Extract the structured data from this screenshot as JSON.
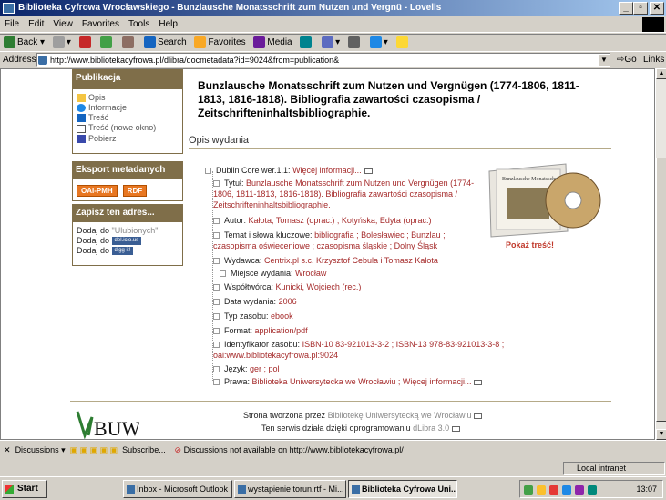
{
  "window": {
    "title": "Biblioteka Cyfrowa Wrocławskiego - Bunzlausche Monatsschrift zum Nutzen und Vergnü - Lovells",
    "menu": [
      "File",
      "Edit",
      "View",
      "Favorites",
      "Tools",
      "Help"
    ],
    "toolbar": {
      "back": "Back",
      "search": "Search",
      "favorites": "Favorites",
      "media": "Media"
    },
    "address_label": "Address",
    "url": "http://www.bibliotekacyfrowa.pl/dlibra/docmetadata?id=9024&from=publication&",
    "go": "Go",
    "links": "Links"
  },
  "sidebar": {
    "publication_title": "Publikacja",
    "publication_links": [
      "Opis",
      "Informacje",
      "Treść",
      "Treść (nowe okno)",
      "Pobierz"
    ],
    "export_title": "Eksport metadanych",
    "export_oai": "OAI-PMH",
    "export_rdf": "RDF",
    "save_title": "Zapisz ten adres...",
    "save_line1_prefix": "Dodaj do",
    "save_line1_value": "\"Ulubionych\"",
    "save_line2": "Dodaj do",
    "save_line3": "Dodaj do",
    "logo_delicious": "del.icio.us",
    "logo_digg": "digg it!"
  },
  "main": {
    "title": "Bunzlausche Monatsschrift zum Nutzen und Vergnügen (1774-1806, 1811-1813, 1816-1818). Bibliografia zawartości czasopisma / Zeitschrifteninhaltsbibliographie.",
    "section": "Opis wydania",
    "dublin_core_label": "Dublin Core wer.1.1:",
    "dublin_core_link": "Więcej informacji...",
    "fields": {
      "title_label": "Tytuł:",
      "title_value": "Bunzlausche Monatsschrift zum Nutzen und Vergnügen (1774-1806, 1811-1813, 1816-1818). Bibliografia zawartości czasopisma / Zeitschrifteninhaltsbibliographie.",
      "author_label": "Autor:",
      "author_value": "Kałota, Tomasz (oprac.) ; Kotyńska, Edyta (oprac.)",
      "subject_label": "Temat i słowa kluczowe:",
      "subject_value1": "bibliografia ; Bolesławiec ; Bunzlau ;",
      "subject_value2": "czasopisma oświeceniowe ; czasopisma śląskie ; Dolny Śląsk",
      "publisher_label": "Wydawca:",
      "publisher_value": "Centrix.pl s.c. Krzysztof Cebula i Tomasz Kałota",
      "place_label": "Miejsce wydania:",
      "place_value": "Wrocław",
      "contributor_label": "Współtwórca:",
      "contributor_value": "Kunicki, Wojciech (rec.)",
      "date_label": "Data wydania:",
      "date_value": "2006",
      "type_label": "Typ zasobu:",
      "type_value": "ebook",
      "format_label": "Format:",
      "format_value": "application/pdf",
      "identifier_label": "Identyfikator zasobu:",
      "identifier_value1": "ISBN-10 83-921013-3-2 ; ISBN-13 978-83-921013-3-8 ;",
      "identifier_value2": "oai:www.bibliotekacyfrowa.pl:9024",
      "language_label": "Język:",
      "language_value": "ger ; pol",
      "rights_label": "Prawa:",
      "rights_value": "Biblioteka Uniwersytecka we Wrocławiu ; Więcej informacji..."
    },
    "show_content": "Pokaż treść!",
    "cd_label": "Bunzlausche Monatsschrift"
  },
  "footer": {
    "line1_prefix": "Strona tworzona przez",
    "line1_link": "Bibliotekę Uniwersytecką we Wrocławiu",
    "line2_prefix": "Ten serwis działa dzięki oprogramowaniu",
    "line2_link": "dLibra 3.0",
    "logo": "BUW"
  },
  "discussions": {
    "label": "Discussions",
    "subscribe": "Subscribe...",
    "message": "Discussions not available on http://www.bibliotekacyfrowa.pl/"
  },
  "status": {
    "zone": "Local intranet"
  },
  "taskbar": {
    "start": "Start",
    "tasks": [
      "Inbox - Microsoft Outlook",
      "wystapienie torun.rtf - Mi...",
      "Biblioteka Cyfrowa Uni..."
    ],
    "clock": "13:07"
  }
}
